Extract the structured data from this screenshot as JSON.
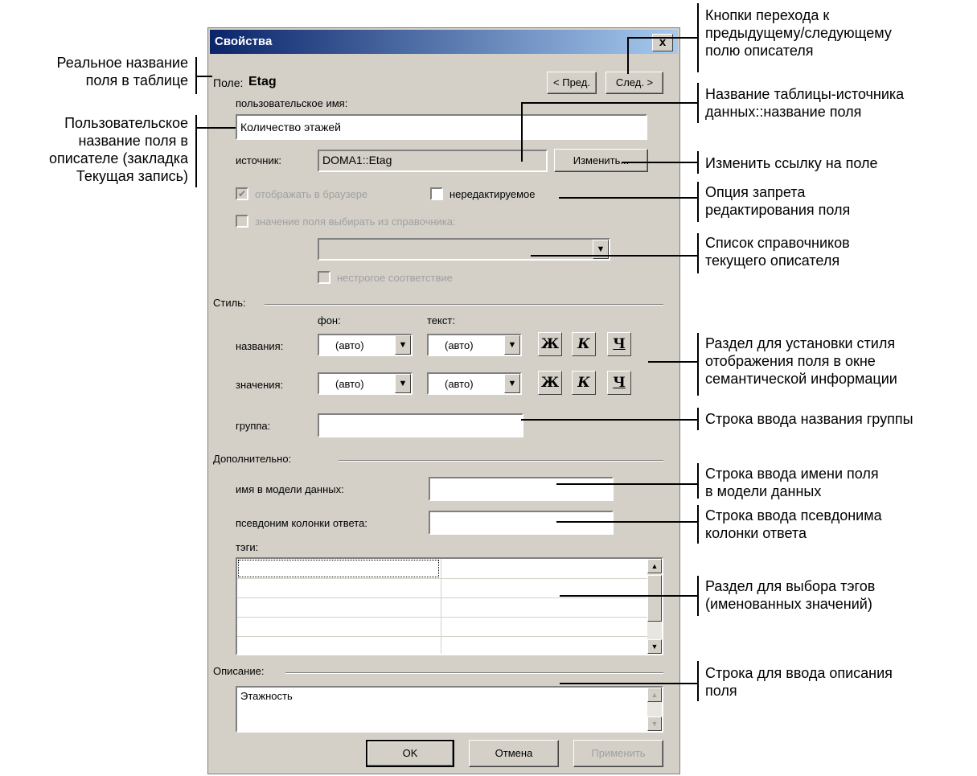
{
  "dialog": {
    "title": "Свойства",
    "close": "x",
    "field_prefix": "Поле:",
    "field_name": "Etag",
    "prev_button": "< Пред.",
    "next_button": "След. >",
    "user_name_label": "пользовательское имя:",
    "user_name_value": "Количество этажей",
    "source_label": "источник:",
    "source_value": "DOMA1::Etag",
    "change_button": "Изменить...",
    "show_in_browser": "отображать в браузере",
    "non_editable": "нередактируемое",
    "from_directory": "значение поля выбирать из справочника:",
    "loose_match": "нестрогое соответствие",
    "style_section": "Стиль:",
    "bg_label": "фон:",
    "text_label": "текст:",
    "names_label": "названия:",
    "values_label": "значения:",
    "auto": "(авто)",
    "bold": "Ж",
    "italic": "К",
    "underline": "Ч",
    "group_label": "группа:",
    "additional_section": "Дополнительно:",
    "model_name_label": "имя в модели данных:",
    "alias_label": "псевдоним колонки ответа:",
    "tags_label": "тэги:",
    "description_section": "Описание:",
    "description_value": "Этажность",
    "ok_button": "OK",
    "cancel_button": "Отмена",
    "apply_button": "Применить"
  },
  "annotations": {
    "real_name": [
      "Реальное название",
      "поля в таблице"
    ],
    "user_name": [
      "Пользовательское",
      "название поля в",
      "описателе (закладка",
      "Текущая запись)"
    ],
    "nav_buttons": [
      "Кнопки перехода к",
      "предыдущему/следующему",
      "полю описателя"
    ],
    "source_table": [
      "Название таблицы-источника",
      "данных::название поля"
    ],
    "change_link": [
      "Изменить ссылку на поле"
    ],
    "no_edit": [
      "Опция запрета",
      "редактирования поля"
    ],
    "directories": [
      "Список справочников",
      "текущего описателя"
    ],
    "style": [
      "Раздел для установки стиля",
      "отображения поля в окне",
      "семантической информации"
    ],
    "group": [
      "Строка ввода названия группы"
    ],
    "model_name": [
      "Строка ввода имени поля",
      "в модели данных"
    ],
    "alias": [
      "Строка ввода псевдонима",
      "колонки ответа"
    ],
    "tags": [
      "Раздел для выбора тэгов",
      "(именованных значений)"
    ],
    "description": [
      "Строка для ввода описания",
      "поля"
    ]
  }
}
